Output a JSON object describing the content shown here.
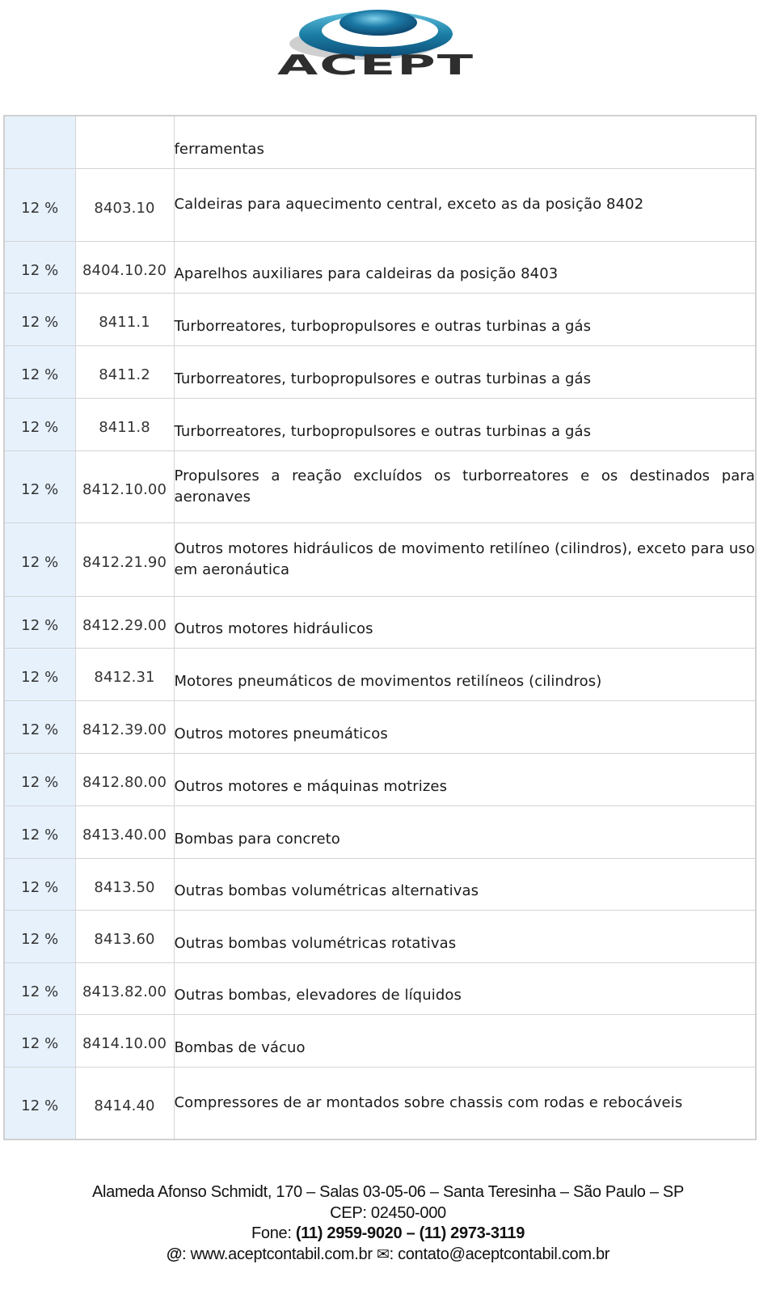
{
  "header": {
    "logo_text": "ACEPT",
    "logo_colors": {
      "ring": "#1c7fa6",
      "ring_dark": "#0d4f79",
      "sphere": "#0a5a86",
      "text": "#2e2e2e",
      "shadow": "#c8c8c8"
    }
  },
  "table": {
    "rows": [
      {
        "rate": "",
        "code": "",
        "description": "ferramentas"
      },
      {
        "rate": "12 %",
        "code": "8403.10",
        "description": "Caldeiras para aquecimento central, exceto as da posição 8402"
      },
      {
        "rate": "12 %",
        "code": "8404.10.20",
        "description": "Aparelhos auxiliares para caldeiras da posição 8403"
      },
      {
        "rate": "12 %",
        "code": "8411.1",
        "description": "Turborreatores, turbopropulsores e outras turbinas a gás"
      },
      {
        "rate": "12 %",
        "code": "8411.2",
        "description": "Turborreatores, turbopropulsores e outras turbinas a gás"
      },
      {
        "rate": "12 %",
        "code": "8411.8",
        "description": "Turborreatores, turbopropulsores e outras turbinas a gás"
      },
      {
        "rate": "12 %",
        "code": "8412.10.00",
        "description": "Propulsores a reação excluídos os turborreatores e os destinados para aeronaves"
      },
      {
        "rate": "12 %",
        "code": "8412.21.90",
        "description": "Outros motores hidráulicos de movimento retilíneo (cilindros), exceto para uso em aeronáutica"
      },
      {
        "rate": "12 %",
        "code": "8412.29.00",
        "description": "Outros motores hidráulicos"
      },
      {
        "rate": "12 %",
        "code": "8412.31",
        "description": "Motores pneumáticos de movimentos retilíneos (cilindros)"
      },
      {
        "rate": "12 %",
        "code": "8412.39.00",
        "description": "Outros motores pneumáticos"
      },
      {
        "rate": "12 %",
        "code": "8412.80.00",
        "description": "Outros motores e máquinas motrizes"
      },
      {
        "rate": "12 %",
        "code": "8413.40.00",
        "description": "Bombas para concreto"
      },
      {
        "rate": "12 %",
        "code": "8413.50",
        "description": "Outras bombas volumétricas alternativas"
      },
      {
        "rate": "12 %",
        "code": "8413.60",
        "description": "Outras bombas volumétricas rotativas"
      },
      {
        "rate": "12 %",
        "code": "8413.82.00",
        "description": "Outras bombas, elevadores de líquidos"
      },
      {
        "rate": "12 %",
        "code": "8414.10.00",
        "description": "Bombas de vácuo"
      },
      {
        "rate": "12 %",
        "code": "8414.40",
        "description": "Compressores de ar montados sobre chassis com rodas e rebocáveis"
      }
    ],
    "rate_column_bg": "#e6f1fc",
    "border_color": "#d4d4d4"
  },
  "footer": {
    "address": "Alameda Afonso Schmidt, 170 – Salas 03-05-06 – Santa Teresinha – São Paulo – SP",
    "cep": "CEP: 02450-000",
    "phone_label": "Fone: ",
    "phone_numbers": "(11) 2959-9020 – (11) 2973-3119",
    "web_icon": "@",
    "web_sep": ": ",
    "website": "www.aceptcontabil.com.br",
    "mail_icon": "✉",
    "mail_sep": ": ",
    "email": "contato@aceptcontabil.com.br"
  }
}
